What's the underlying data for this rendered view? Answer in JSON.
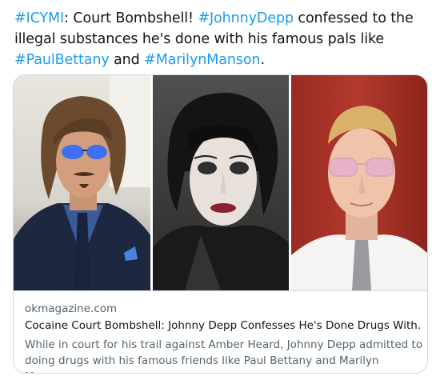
{
  "tweet": {
    "tag_icymi": "#ICYMI",
    "text_1": ": Court Bombshell! ",
    "tag_depp": "#JohnnyDepp",
    "text_2": " confessed to the illegal substances he's done with his famous pals like ",
    "tag_bettany": "#PaulBettany",
    "text_3": " and ",
    "tag_manson": "#MarilynManson",
    "text_4": "."
  },
  "card": {
    "domain": "okmagazine.com",
    "title": "Cocaine Court Bombshell: Johnny Depp Confesses He's Done Drugs With...",
    "description": "While in court for his trail against Amber Heard, Johnny Depp admitted to doing drugs with his famous friends like Paul Bettany and Marilyn Manson."
  },
  "colors": {
    "link": "#1d9bf0",
    "text": "#0f1419",
    "secondary_text": "#536471",
    "border": "#cfd9de"
  }
}
